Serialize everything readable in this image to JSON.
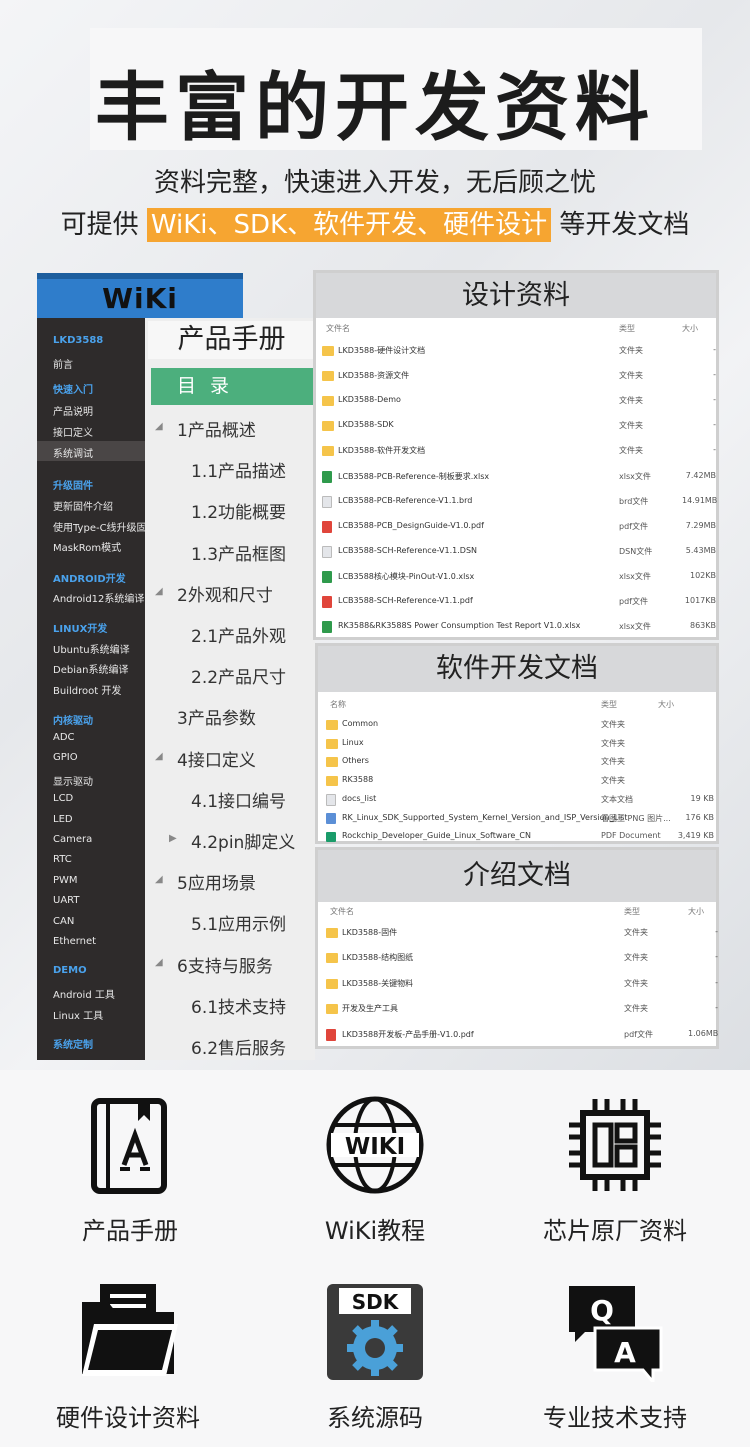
{
  "header": {
    "title": "丰富的开发资料",
    "subtitle": "资料完整，快速进入开发，无后顾之忧",
    "line2_prefix": "可提供 ",
    "line2_highlight": "WiKi、SDK、软件开发、硬件设计",
    "line2_suffix": " 等开发文档"
  },
  "wiki": {
    "title": "WiKi",
    "sidebar": [
      {
        "label": "LKD3588",
        "cat": true
      },
      {
        "label": "前言",
        "cat": false
      },
      {
        "label": "快速入门",
        "cat": true
      },
      {
        "label": "产品说明",
        "cat": false
      },
      {
        "label": "接口定义",
        "cat": false
      },
      {
        "label": "系统调试",
        "cat": false,
        "selected": true
      },
      {
        "label": "升级固件",
        "cat": true
      },
      {
        "label": "更新固件介绍",
        "cat": false
      },
      {
        "label": "使用Type-C线升级固",
        "cat": false
      },
      {
        "label": "MaskRom模式",
        "cat": false
      },
      {
        "label": "ANDROID开发",
        "cat": true
      },
      {
        "label": "Android12系统编译",
        "cat": false
      },
      {
        "label": "LINUX开发",
        "cat": true
      },
      {
        "label": "Ubuntu系统编译",
        "cat": false
      },
      {
        "label": "Debian系统编译",
        "cat": false
      },
      {
        "label": "Buildroot 开发",
        "cat": false
      },
      {
        "label": "内核驱动",
        "cat": true
      },
      {
        "label": "ADC",
        "cat": false
      },
      {
        "label": "GPIO",
        "cat": false
      },
      {
        "label": "显示驱动",
        "cat": false
      },
      {
        "label": "LCD",
        "cat": false
      },
      {
        "label": "LED",
        "cat": false
      },
      {
        "label": "Camera",
        "cat": false
      },
      {
        "label": "RTC",
        "cat": false
      },
      {
        "label": "PWM",
        "cat": false
      },
      {
        "label": "UART",
        "cat": false
      },
      {
        "label": "CAN",
        "cat": false
      },
      {
        "label": "Ethernet",
        "cat": false
      },
      {
        "label": "DEMO",
        "cat": true
      },
      {
        "label": "Android 工具",
        "cat": false
      },
      {
        "label": "Linux 工具",
        "cat": false
      },
      {
        "label": "系统定制",
        "cat": true
      }
    ],
    "toc_title": "产品手册",
    "toc_header": "目 录",
    "toc": [
      {
        "label": "1产品概述",
        "level": 1,
        "arrow": "down"
      },
      {
        "label": "1.1产品描述",
        "level": 2
      },
      {
        "label": "1.2功能概要",
        "level": 2
      },
      {
        "label": "1.3产品框图",
        "level": 2
      },
      {
        "label": "2外观和尺寸",
        "level": 1,
        "arrow": "down"
      },
      {
        "label": "2.1产品外观",
        "level": 2
      },
      {
        "label": "2.2产品尺寸",
        "level": 2
      },
      {
        "label": "3产品参数",
        "level": 1
      },
      {
        "label": "4接口定义",
        "level": 1,
        "arrow": "down"
      },
      {
        "label": "4.1接口编号",
        "level": 2
      },
      {
        "label": "4.2pin脚定义",
        "level": 2,
        "arrow": "right"
      },
      {
        "label": "5应用场景",
        "level": 1,
        "arrow": "down"
      },
      {
        "label": "5.1应用示例",
        "level": 2
      },
      {
        "label": "6支持与服务",
        "level": 1,
        "arrow": "down"
      },
      {
        "label": "6.1技术支持",
        "level": 2
      },
      {
        "label": "6.2售后服务",
        "level": 2
      }
    ]
  },
  "design": {
    "title": "设计资料",
    "cols": [
      "文件名",
      "类型",
      "大小"
    ],
    "rows": [
      {
        "icon": "folder",
        "name": "LKD3588-硬件设计文档",
        "type": "文件夹",
        "size": "-"
      },
      {
        "icon": "folder",
        "name": "LKD3588-资源文件",
        "type": "文件夹",
        "size": "-"
      },
      {
        "icon": "folder",
        "name": "LKD3588-Demo",
        "type": "文件夹",
        "size": "-"
      },
      {
        "icon": "folder",
        "name": "LKD3588-SDK",
        "type": "文件夹",
        "size": "-"
      },
      {
        "icon": "folder",
        "name": "LKD3588-软件开发文档",
        "type": "文件夹",
        "size": "-"
      },
      {
        "icon": "xlsx",
        "name": "LCB3588-PCB-Reference-制板要求.xlsx",
        "type": "xlsx文件",
        "size": "7.42MB"
      },
      {
        "icon": "gen",
        "name": "LCB3588-PCB-Reference-V1.1.brd",
        "type": "brd文件",
        "size": "14.91MB"
      },
      {
        "icon": "pdf",
        "name": "LCB3588-PCB_DesignGuide-V1.0.pdf",
        "type": "pdf文件",
        "size": "7.29MB"
      },
      {
        "icon": "gen",
        "name": "LCB3588-SCH-Reference-V1.1.DSN",
        "type": "DSN文件",
        "size": "5.43MB"
      },
      {
        "icon": "xlsx",
        "name": "LCB3588核心模块-PinOut-V1.0.xlsx",
        "type": "xlsx文件",
        "size": "102KB"
      },
      {
        "icon": "pdf",
        "name": "LCB3588-SCH-Reference-V1.1.pdf",
        "type": "pdf文件",
        "size": "1017KB"
      },
      {
        "icon": "xlsx",
        "name": "RK3588&RK3588S Power Consumption Test Report V1.0.xlsx",
        "type": "xlsx文件",
        "size": "863KB"
      }
    ]
  },
  "software": {
    "title": "软件开发文档",
    "cols": [
      "名称",
      "类型",
      "大小"
    ],
    "rows": [
      {
        "icon": "folder",
        "name": "Common",
        "type": "文件夹",
        "size": ""
      },
      {
        "icon": "folder",
        "name": "Linux",
        "type": "文件夹",
        "size": ""
      },
      {
        "icon": "folder",
        "name": "Others",
        "type": "文件夹",
        "size": ""
      },
      {
        "icon": "folder",
        "name": "RK3588",
        "type": "文件夹",
        "size": ""
      },
      {
        "icon": "gen",
        "name": "docs_list",
        "type": "文本文档",
        "size": "19 KB"
      },
      {
        "icon": "png",
        "name": "RK_Linux_SDK_Supported_System_Kernel_Version_and_ISP_Version_List",
        "type": "看图王 PNG 图片...",
        "size": "176 KB"
      },
      {
        "icon": "cn",
        "name": "Rockchip_Developer_Guide_Linux_Software_CN",
        "type": "PDF Document",
        "size": "3,419 KB"
      }
    ]
  },
  "intro": {
    "title": "介绍文档",
    "cols": [
      "文件名",
      "类型",
      "大小"
    ],
    "rows": [
      {
        "icon": "folder",
        "name": "LKD3588-固件",
        "type": "文件夹",
        "size": "-"
      },
      {
        "icon": "folder",
        "name": "LKD3588-结构图纸",
        "type": "文件夹",
        "size": "-"
      },
      {
        "icon": "folder",
        "name": "LKD3588-关键物料",
        "type": "文件夹",
        "size": "-"
      },
      {
        "icon": "folder",
        "name": "开发及生产工具",
        "type": "文件夹",
        "size": "-"
      },
      {
        "icon": "pdf",
        "name": "LKD3588开发板-产品手册-V1.0.pdf",
        "type": "pdf文件",
        "size": "1.06MB"
      }
    ]
  },
  "features": [
    {
      "label": "产品手册",
      "icon": "manual-icon"
    },
    {
      "label": "WiKi教程",
      "icon": "wiki-icon",
      "icon_text": "WIKI"
    },
    {
      "label": "芯片原厂资料",
      "icon": "chip-icon"
    },
    {
      "label": "硬件设计资料",
      "icon": "folder-docs-icon"
    },
    {
      "label": "系统源码",
      "icon": "sdk-gear-icon",
      "icon_text": "SDK"
    },
    {
      "label": "专业技术支持",
      "icon": "qa-icon",
      "icon_text": [
        "Q",
        "A"
      ]
    }
  ]
}
